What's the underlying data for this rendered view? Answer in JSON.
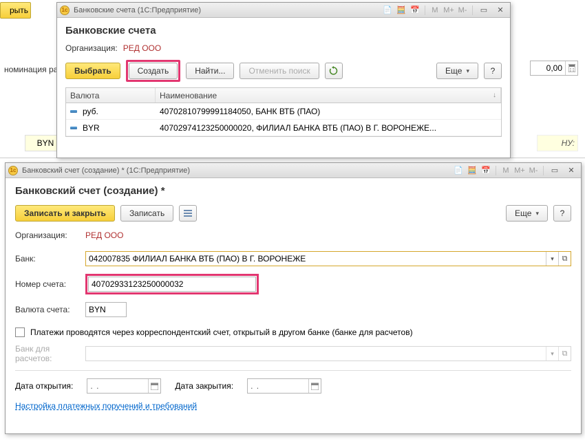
{
  "bg": {
    "close": "рыть",
    "nomination": "номинация ра",
    "amount": "0,00",
    "currency": "BYN",
    "hu": "НУ:"
  },
  "win1": {
    "titlebar": "Банковские счета  (1С:Предприятие)",
    "title": "Банковские счета",
    "org_label": "Организация:",
    "org_value": "РЕД ООО",
    "btn_select": "Выбрать",
    "btn_create": "Создать",
    "btn_find": "Найти...",
    "btn_cancel_search": "Отменить поиск",
    "btn_more": "Еще",
    "btn_help": "?",
    "grid": {
      "col_currency": "Валюта",
      "col_name": "Наименование",
      "rows": [
        {
          "currency": "руб.",
          "name": "40702810799991184050, БАНК ВТБ (ПАО)"
        },
        {
          "currency": "BYR",
          "name": "40702974123250000020, ФИЛИАЛ БАНКА ВТБ (ПАО) В Г. ВОРОНЕЖЕ..."
        }
      ]
    }
  },
  "win2": {
    "titlebar": "Банковский счет (создание) * (1С:Предприятие)",
    "title": "Банковский счет (создание) *",
    "btn_save_close": "Записать и закрыть",
    "btn_save": "Записать",
    "btn_more": "Еще",
    "btn_help": "?",
    "org_label": "Организация:",
    "org_value": "РЕД ООО",
    "bank_label": "Банк:",
    "bank_value": "042007835 ФИЛИАЛ БАНКА ВТБ (ПАО) В Г. ВОРОНЕЖЕ",
    "account_label": "Номер счета:",
    "account_value": "40702933123250000032",
    "currency_label": "Валюта счета:",
    "currency_value": "BYN",
    "checkbox_label": "Платежи проводятся через корреспондентский счет, открытый в другом банке (банке для расчетов)",
    "bank_calc_label": "Банк для расчетов:",
    "date_open_label": "Дата открытия:",
    "date_close_label": "Дата закрытия:",
    "date_placeholder": ".  .",
    "link": "Настройка платежных поручений и требований"
  },
  "titlebar_markers": {
    "m": "M",
    "mp": "M+",
    "mm": "M-"
  }
}
